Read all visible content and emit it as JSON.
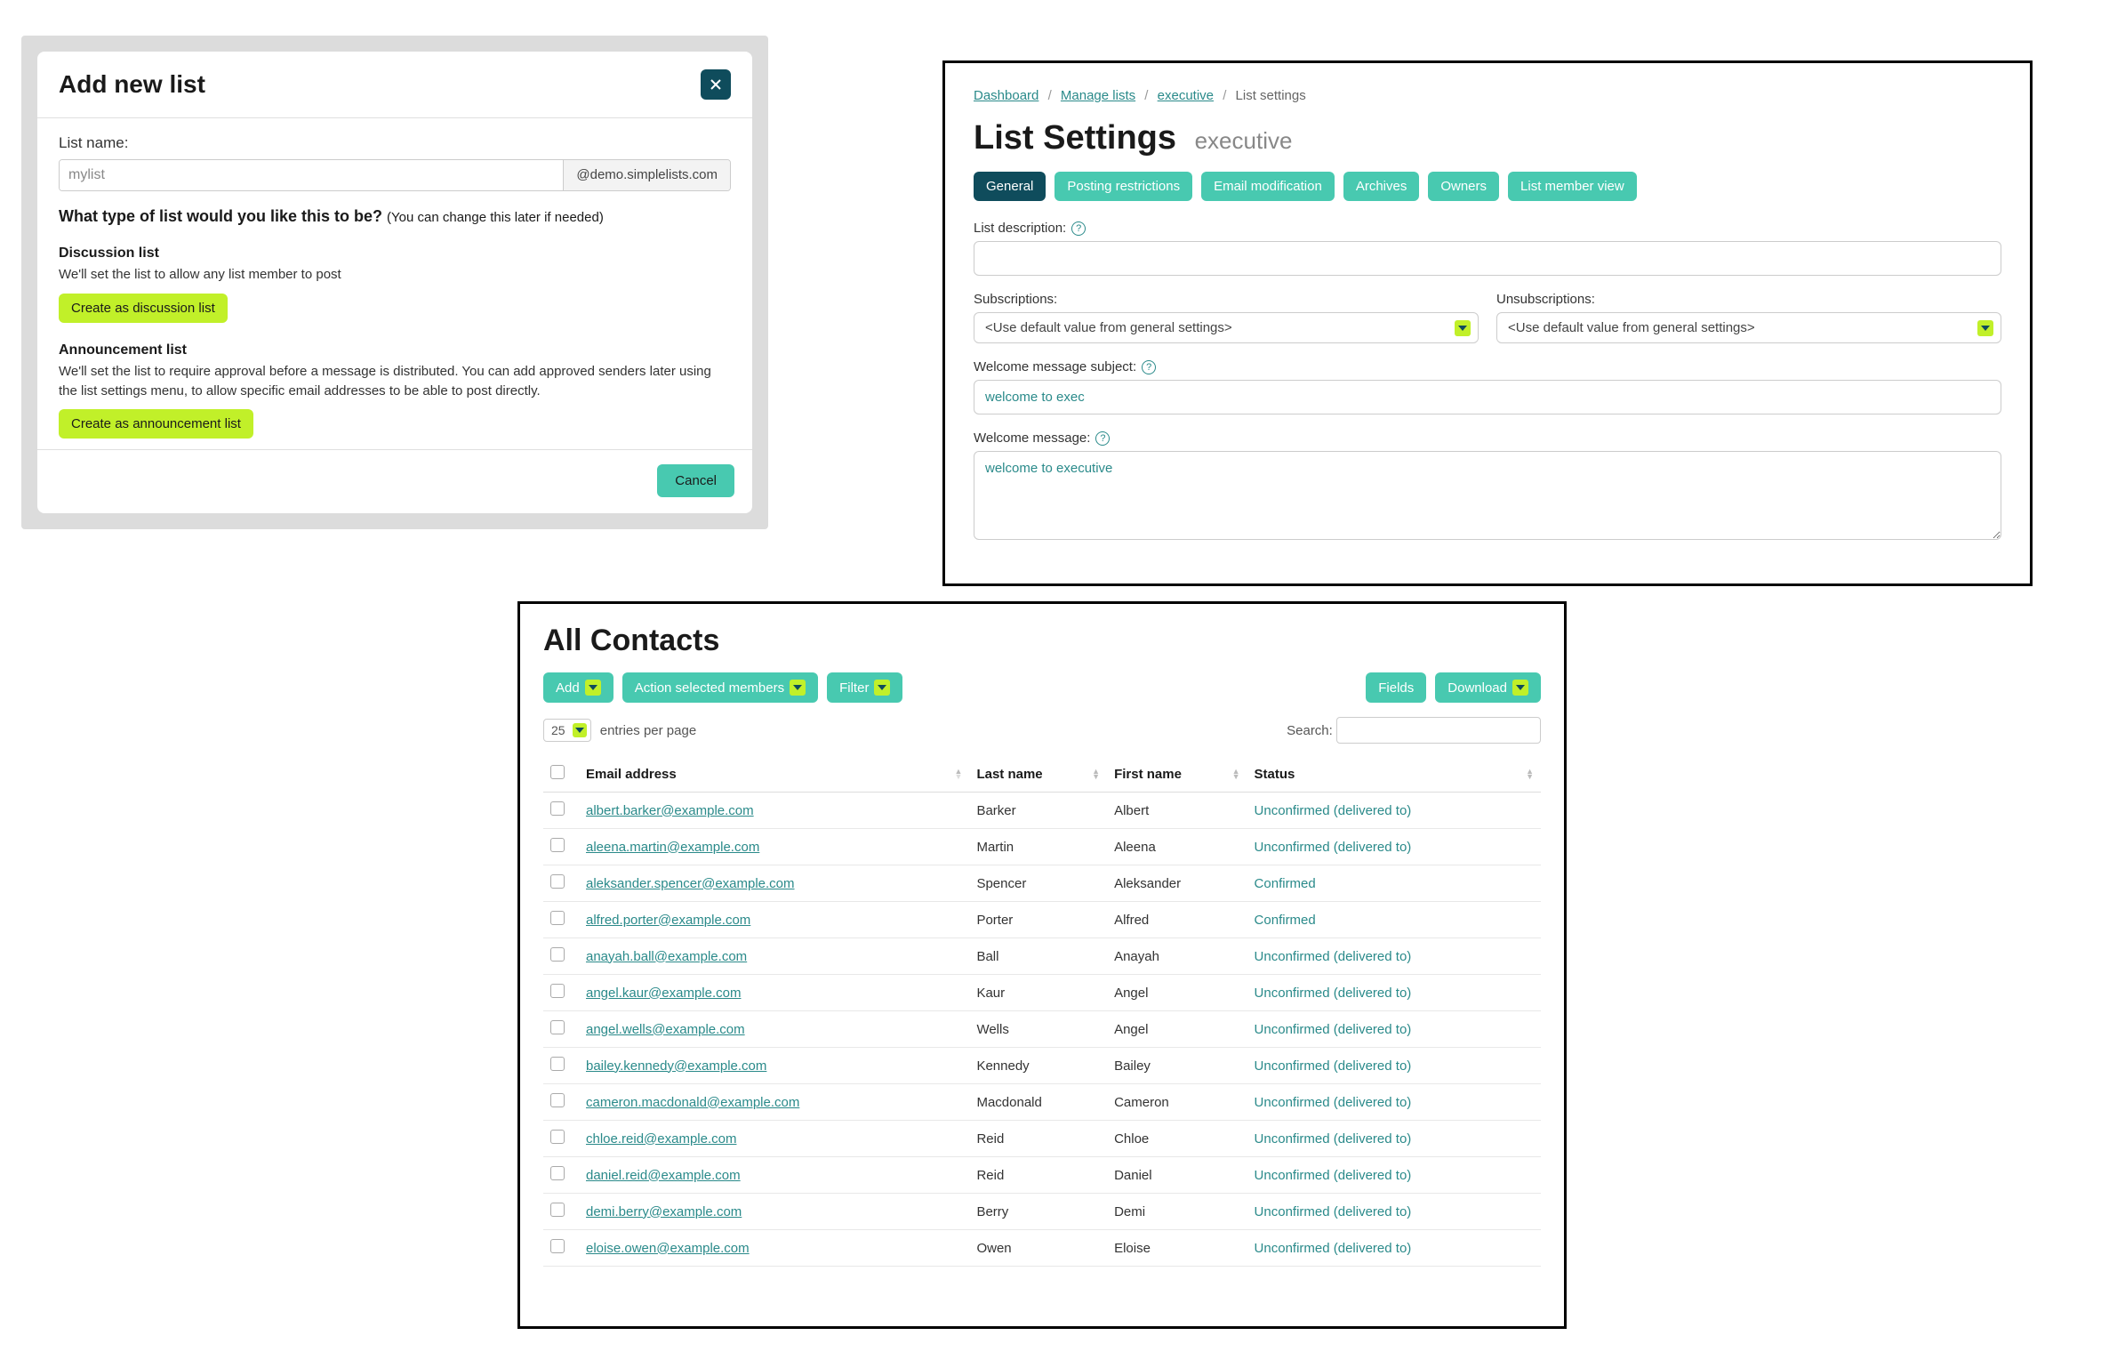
{
  "modal": {
    "title": "Add new list",
    "list_name_label": "List name:",
    "list_name_value": "mylist",
    "domain_suffix": "@demo.simplelists.com",
    "question": "What type of list would you like this to be?",
    "question_note": "(You can change this later if needed)",
    "discussion": {
      "title": "Discussion list",
      "desc": "We'll set the list to allow any list member to post",
      "button": "Create as discussion list"
    },
    "announcement": {
      "title": "Announcement list",
      "desc": "We'll set the list to require approval before a message is distributed. You can add approved senders later using the list settings menu, to allow specific email addresses to be able to post directly.",
      "button": "Create as announcement list"
    },
    "cancel": "Cancel"
  },
  "settings": {
    "breadcrumb": {
      "dashboard": "Dashboard",
      "manage": "Manage lists",
      "executive": "executive",
      "current": "List settings"
    },
    "title": "List Settings",
    "subtitle": "executive",
    "tabs": [
      "General",
      "Posting restrictions",
      "Email modification",
      "Archives",
      "Owners",
      "List member view"
    ],
    "list_desc_label": "List description:",
    "subscriptions_label": "Subscriptions:",
    "unsubscriptions_label": "Unsubscriptions:",
    "default_value_text": "<Use default value from general settings>",
    "welcome_subject_label": "Welcome message subject:",
    "welcome_subject_value": "welcome to exec",
    "welcome_msg_label": "Welcome message:",
    "welcome_msg_value": "welcome to executive"
  },
  "contacts": {
    "title": "All Contacts",
    "btn_add": "Add",
    "btn_action": "Action selected members",
    "btn_filter": "Filter",
    "btn_fields": "Fields",
    "btn_download": "Download",
    "entries_value": "25",
    "entries_label": "entries per page",
    "search_label": "Search:",
    "columns": {
      "email": "Email address",
      "last": "Last name",
      "first": "First name",
      "status": "Status"
    },
    "rows": [
      {
        "email": "albert.barker@example.com",
        "last": "Barker",
        "first": "Albert",
        "status": "Unconfirmed (delivered to)"
      },
      {
        "email": "aleena.martin@example.com",
        "last": "Martin",
        "first": "Aleena",
        "status": "Unconfirmed (delivered to)"
      },
      {
        "email": "aleksander.spencer@example.com",
        "last": "Spencer",
        "first": "Aleksander",
        "status": "Confirmed"
      },
      {
        "email": "alfred.porter@example.com",
        "last": "Porter",
        "first": "Alfred",
        "status": "Confirmed"
      },
      {
        "email": "anayah.ball@example.com",
        "last": "Ball",
        "first": "Anayah",
        "status": "Unconfirmed (delivered to)"
      },
      {
        "email": "angel.kaur@example.com",
        "last": "Kaur",
        "first": "Angel",
        "status": "Unconfirmed (delivered to)"
      },
      {
        "email": "angel.wells@example.com",
        "last": "Wells",
        "first": "Angel",
        "status": "Unconfirmed (delivered to)"
      },
      {
        "email": "bailey.kennedy@example.com",
        "last": "Kennedy",
        "first": "Bailey",
        "status": "Unconfirmed (delivered to)"
      },
      {
        "email": "cameron.macdonald@example.com",
        "last": "Macdonald",
        "first": "Cameron",
        "status": "Unconfirmed (delivered to)"
      },
      {
        "email": "chloe.reid@example.com",
        "last": "Reid",
        "first": "Chloe",
        "status": "Unconfirmed (delivered to)"
      },
      {
        "email": "daniel.reid@example.com",
        "last": "Reid",
        "first": "Daniel",
        "status": "Unconfirmed (delivered to)"
      },
      {
        "email": "demi.berry@example.com",
        "last": "Berry",
        "first": "Demi",
        "status": "Unconfirmed (delivered to)"
      },
      {
        "email": "eloise.owen@example.com",
        "last": "Owen",
        "first": "Eloise",
        "status": "Unconfirmed (delivered to)"
      }
    ]
  }
}
